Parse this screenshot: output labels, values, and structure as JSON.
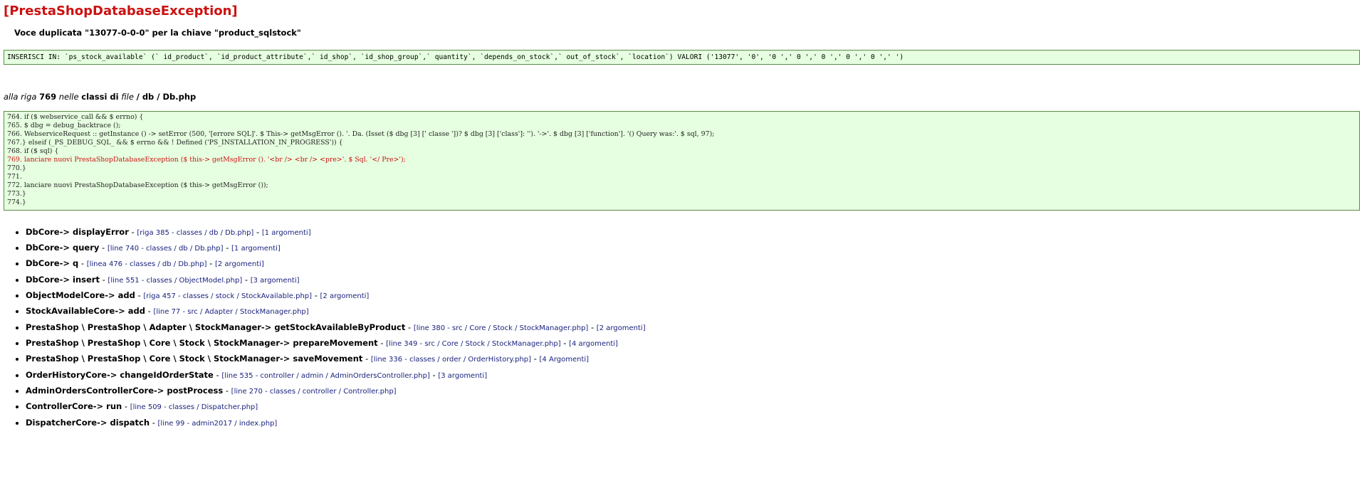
{
  "title": "[PrestaShopDatabaseException]",
  "message": "Voce duplicata \"13077-0-0-0\" per la chiave \"product_sqlstock\"",
  "sql": "INSERISCI IN: `ps_stock_available` (` id_product`, `id_product_attribute`,` id_shop`, `id_shop_group`,` quantity`, `depends_on_stock`,` out_of_stock`, `location`) VALORI ('13077', '0', '0 ',' 0 ',' 0 ',' 0 ',' 0 ',' ')",
  "location": {
    "prefix_italic": "alla riga",
    "line_number": "769",
    "middle_italic": "nelle",
    "classi_di": "classi di",
    "file_italic": "file",
    "path": "/ db / Db.php"
  },
  "code_lines": [
    {
      "text": "764. if ($ webservice_call && $ errno) {",
      "highlight": false
    },
    {
      "text": "765. $ dbg = debug_backtrace ();",
      "highlight": false
    },
    {
      "text": "766. WebserviceRequest :: getInstance () -> setError (500, '[errore SQL]'. $ This-> getMsgError (). '. Da. (Isset ($ dbg [3] [' classe '])? $ dbg [3] ['class']: ''). '->'. $ dbg [3] ['function']. '() Query was:'. $ sql, 97);",
      "highlight": false
    },
    {
      "text": "767.} elseif (_PS_DEBUG_SQL_ && $ errno && ! Defined ('PS_INSTALLATION_IN_PROGRESS')) {",
      "highlight": false
    },
    {
      "text": "768. if ($ sql) {",
      "highlight": false
    },
    {
      "text": "769. lanciare nuovi PrestaShopDatabaseException ($ this-> getMsgError (). '<br /> <br /> <pre>'. $ Sql. '</ Pre>');",
      "highlight": true
    },
    {
      "text": "770.}",
      "highlight": false
    },
    {
      "text": "771.",
      "highlight": false
    },
    {
      "text": "772. lanciare nuovi PrestaShopDatabaseException ($ this-> getMsgError ());",
      "highlight": false
    },
    {
      "text": "773.}",
      "highlight": false
    },
    {
      "text": "774.}",
      "highlight": false
    }
  ],
  "trace": [
    {
      "fn": "DbCore-> displayError",
      "link1": "[riga 385 - classes / db / Db.php]",
      "link2": "[1 argomenti]"
    },
    {
      "fn": "DbCore-> query",
      "link1": "[line 740 - classes / db / Db.php]",
      "link2": "[1 argomenti]"
    },
    {
      "fn": "DbCore-> q",
      "link1": "[linea 476 - classes / db / Db.php]",
      "link2": "[2 argomenti]"
    },
    {
      "fn": "DbCore-> insert",
      "link1": "[line 551 - classes / ObjectModel.php]",
      "link2": "[3 argomenti]"
    },
    {
      "fn": "ObjectModelCore-> add",
      "link1": "[riga 457 - classes / stock / StockAvailable.php]",
      "link2": "[2 argomenti]"
    },
    {
      "fn": "StockAvailableCore-> add",
      "link1": "[line 77 - src / Adapter / StockManager.php]",
      "link2": null
    },
    {
      "fn": "PrestaShop \\ PrestaShop \\ Adapter \\ StockManager-> getStockAvailableByProduct",
      "link1": "[line 380 - src / Core / Stock / StockManager.php]",
      "link2": "[2 argomenti]"
    },
    {
      "fn": "PrestaShop \\ PrestaShop \\ Core \\ Stock \\ StockManager-> prepareMovement",
      "link1": "[line 349 - src / Core / Stock / StockManager.php]",
      "link2": "[4 argomenti]"
    },
    {
      "fn": "PrestaShop \\ PrestaShop \\ Core \\ Stock \\ StockManager-> saveMovement",
      "link1": "[line 336 - classes / order / OrderHistory.php]",
      "link2": "[4 Argomenti]"
    },
    {
      "fn": "OrderHistoryCore-> changeIdOrderState",
      "link1": "[line 535 - controller / admin / AdminOrdersController.php]",
      "link2": "[3 argomenti]"
    },
    {
      "fn": "AdminOrdersControllerCore-> postProcess",
      "link1": "[line 270 - classes / controller / Controller.php]",
      "link2": null
    },
    {
      "fn": "ControllerCore-> run",
      "link1": "[line 509 - classes / Dispatcher.php]",
      "link2": null
    },
    {
      "fn": "DispatcherCore-> dispatch",
      "link1": "[line 99 - admin2017 / index.php]",
      "link2": null
    }
  ]
}
